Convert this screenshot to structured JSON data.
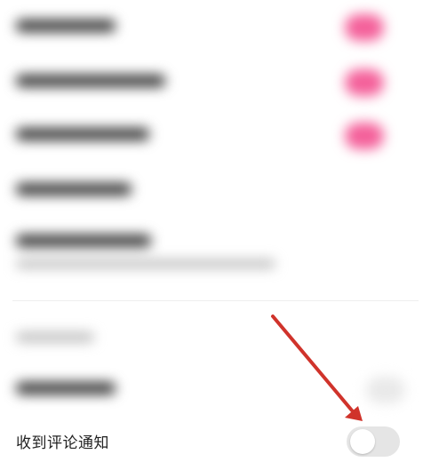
{
  "settings": {
    "comment_notification": {
      "label": "收到评论通知",
      "enabled": false
    }
  },
  "annotation": {
    "arrow_color": "#d0332b"
  },
  "colors": {
    "toggle_on": "#f4609a",
    "toggle_off": "#e5e5e5"
  }
}
